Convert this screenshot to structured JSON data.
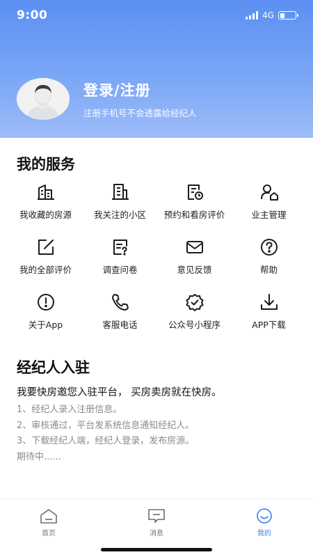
{
  "status": {
    "time": "9:00",
    "network": "4G",
    "battery_level": 0.3
  },
  "profile": {
    "login_title": "登录/注册",
    "login_subtitle": "注册手机号不会透露给经纪人"
  },
  "services": {
    "title": "我的服务",
    "items": [
      {
        "label": "我收藏的房源",
        "icon": "building-star-icon"
      },
      {
        "label": "我关注的小区",
        "icon": "apartment-icon"
      },
      {
        "label": "预约和看房评价",
        "icon": "document-clock-icon"
      },
      {
        "label": "业主管理",
        "icon": "user-home-icon"
      },
      {
        "label": "我的全部评价",
        "icon": "edit-square-icon"
      },
      {
        "label": "调查问卷",
        "icon": "questionnaire-icon"
      },
      {
        "label": "意见反馈",
        "icon": "envelope-icon"
      },
      {
        "label": "帮助",
        "icon": "question-circle-icon"
      },
      {
        "label": "关于App",
        "icon": "info-circle-icon"
      },
      {
        "label": "客服电话",
        "icon": "phone-icon"
      },
      {
        "label": "公众号小程序",
        "icon": "badge-check-icon"
      },
      {
        "label": "APP下载",
        "icon": "download-icon"
      }
    ]
  },
  "agent": {
    "title": "经纪人入驻",
    "lead": "我要快房邀您入驻平台， 买房卖房就在快房。",
    "items": [
      "1、经纪人录入注册信息。",
      "2、审核通过，平台发系统信息通知经纪人。",
      "3、下载经纪人端，经纪人登录，发布房源。",
      "期待中......"
    ]
  },
  "tabbar": {
    "tabs": [
      {
        "label": "首页",
        "icon": "home-icon",
        "active": false
      },
      {
        "label": "消息",
        "icon": "message-icon",
        "active": false
      },
      {
        "label": "我的",
        "icon": "smile-icon",
        "active": true
      }
    ]
  },
  "colors": {
    "accent": "#3d7cf0",
    "header_top": "#5b8ff2",
    "header_bottom": "#9cbcf8"
  }
}
